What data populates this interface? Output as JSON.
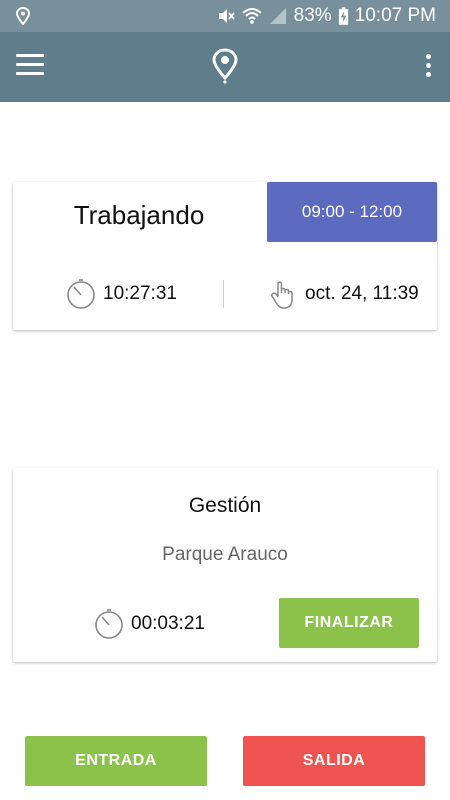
{
  "status_bar": {
    "battery": "83%",
    "time": "10:07 PM",
    "icons": [
      "location-pin-icon",
      "mute-icon",
      "wifi-icon",
      "signal-icon",
      "battery-charging-icon"
    ]
  },
  "app_bar": {
    "menu_icon": "hamburger-menu-icon",
    "logo_icon": "location-pin-logo-icon",
    "overflow_icon": "more-vert-icon"
  },
  "work_card": {
    "status": "Trabajando",
    "schedule": "09:00 - 12:00",
    "elapsed": "10:27:31",
    "last_punch": "oct. 24, 11:39"
  },
  "task_card": {
    "title": "Gestión",
    "place": "Parque Arauco",
    "elapsed": "00:03:21",
    "finish_label": "FINALIZAR"
  },
  "actions": {
    "entrada_label": "ENTRADA",
    "salida_label": "SALIDA"
  },
  "colors": {
    "status_bar": "#78909c",
    "app_bar": "#607d8b",
    "schedule": "#5c6bc0",
    "green": "#8bc34a",
    "red": "#ef5350"
  }
}
